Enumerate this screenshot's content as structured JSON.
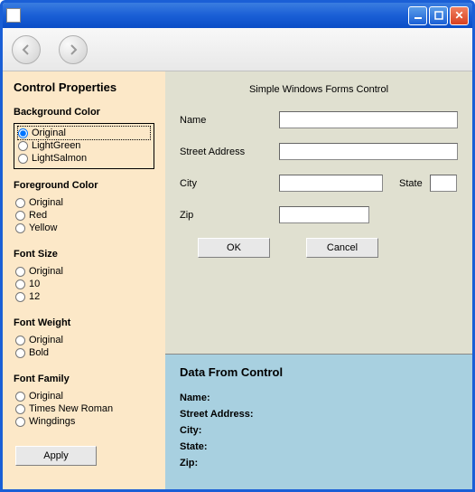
{
  "sidebar": {
    "title": "Control Properties",
    "groups": {
      "bgcolor": {
        "heading": "Background Color",
        "options": [
          "Original",
          "LightGreen",
          "LightSalmon"
        ],
        "selected": 0
      },
      "fgcolor": {
        "heading": "Foreground Color",
        "options": [
          "Original",
          "Red",
          "Yellow"
        ]
      },
      "fontsize": {
        "heading": "Font Size",
        "options": [
          "Original",
          "10",
          "12"
        ]
      },
      "fontweight": {
        "heading": "Font Weight",
        "options": [
          "Original",
          "Bold"
        ]
      },
      "fontfamily": {
        "heading": "Font Family",
        "options": [
          "Original",
          "Times New Roman",
          "Wingdings"
        ]
      }
    },
    "apply_label": "Apply"
  },
  "form": {
    "title": "Simple Windows Forms Control",
    "labels": {
      "name": "Name",
      "street": "Street Address",
      "city": "City",
      "state": "State",
      "zip": "Zip"
    },
    "values": {
      "name": "",
      "street": "",
      "city": "",
      "state": "",
      "zip": ""
    },
    "ok_label": "OK",
    "cancel_label": "Cancel"
  },
  "data_panel": {
    "title": "Data From Control",
    "labels": {
      "name": "Name:",
      "street": "Street Address:",
      "city": "City:",
      "state": "State:",
      "zip": "Zip:"
    }
  }
}
